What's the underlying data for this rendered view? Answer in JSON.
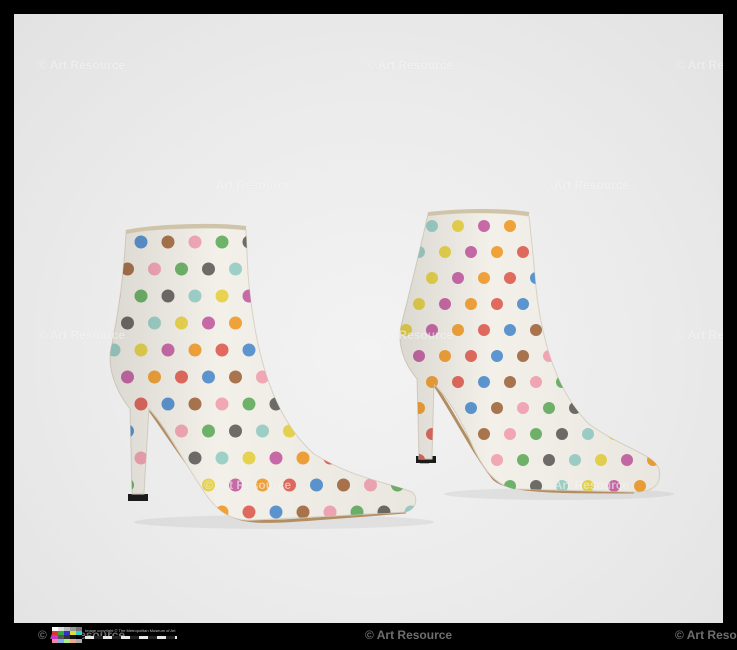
{
  "watermark": {
    "text": "© Art Resource"
  },
  "footer": {
    "copyright": "Image copyright © The Metropolitan Museum of Art",
    "credit_center": "© Art Resource",
    "credit_right": "© Art Resource",
    "credit_left": "© Art Resource"
  },
  "subject": {
    "upper_color": "#f3f0e9",
    "dot_colors": [
      "#e06a5e",
      "#e7d34f",
      "#6fb26a",
      "#5c95cf",
      "#c86aa8",
      "#6d6c68",
      "#a9754e",
      "#f0a23a",
      "#9ed0c8",
      "#f2a7b5"
    ]
  }
}
